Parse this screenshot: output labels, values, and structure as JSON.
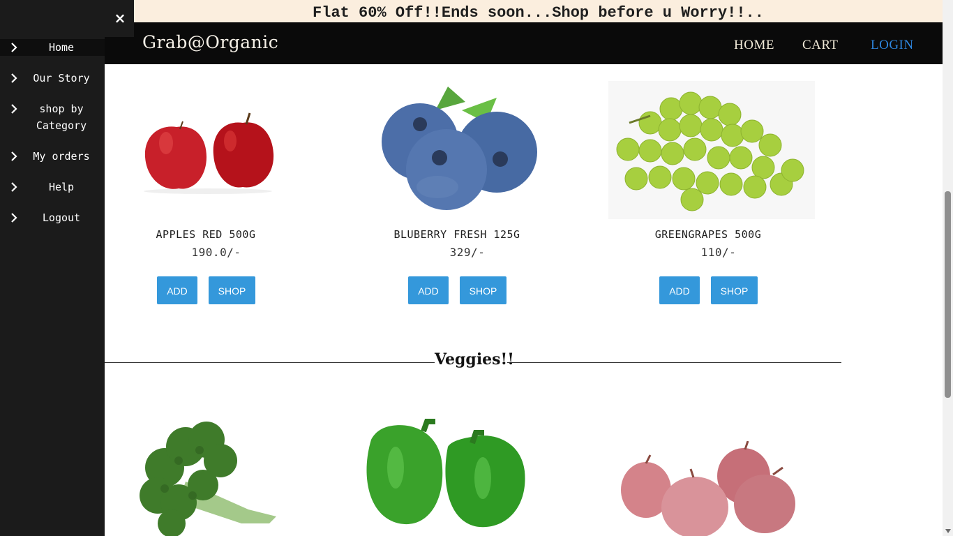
{
  "promo": {
    "text": "Flat 60% Off!!Ends soon...Shop before u Worry!!.."
  },
  "sidebar": {
    "close_label": "×",
    "items": [
      {
        "label": "Home"
      },
      {
        "label": "Our Story"
      },
      {
        "label": "shop by Category"
      },
      {
        "label": "My orders"
      },
      {
        "label": "Help"
      },
      {
        "label": "Logout"
      }
    ]
  },
  "navbar": {
    "brand": "Grab@Organic",
    "links": {
      "home": "HOME",
      "cart": "CART",
      "login": "LOGIN"
    }
  },
  "products": [
    {
      "name": "APPLES RED 500G",
      "price": "190.0/-",
      "add_label": "ADD",
      "shop_label": "SHOP"
    },
    {
      "name": "BLUBERRY FRESH 125G",
      "price": "329/-",
      "add_label": "ADD",
      "shop_label": "SHOP"
    },
    {
      "name": "GREENGRAPES 500G",
      "price": "110/-",
      "add_label": "ADD",
      "shop_label": "SHOP"
    }
  ],
  "veggies_section": {
    "title": "Veggies!!"
  },
  "colors": {
    "sidebar_bg": "#1b1b1b",
    "navbar_bg": "#0a0a0a",
    "promo_bg": "#fbeede",
    "button_blue": "#3498db",
    "login_link": "#2e86de"
  }
}
